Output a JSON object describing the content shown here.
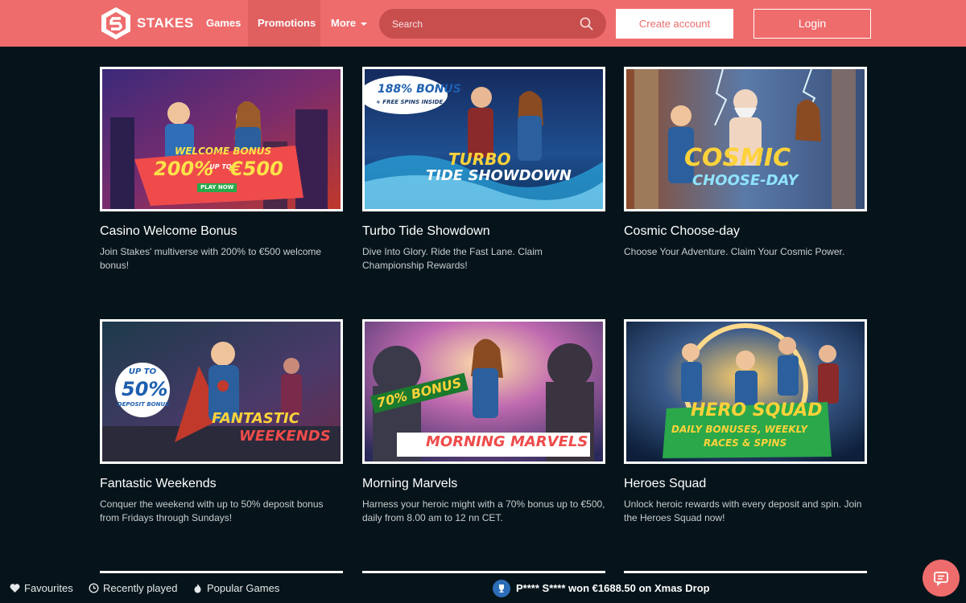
{
  "header": {
    "brand": "STAKES",
    "nav": {
      "games": "Games",
      "promotions": "Promotions",
      "more": "More"
    },
    "search": {
      "placeholder": "Search"
    },
    "create_account": "Create account",
    "login": "Login",
    "colors": {
      "accent": "#ef6c6c",
      "active_nav": "#e05f5f",
      "background": "#05141a"
    }
  },
  "promotions": [
    {
      "title": "Casino Welcome Bonus",
      "description": "Join Stakes' multiverse with 200% to €500 welcome bonus!",
      "banner": {
        "line1": "WELCOME BONUS",
        "line2": "200%",
        "line3": "UP TO",
        "line4": "€500",
        "cta": "PLAY NOW"
      }
    },
    {
      "title": "Turbo Tide Showdown",
      "description": "Dive Into Glory. Ride the Fast Lane. Claim Championship Rewards!",
      "banner": {
        "line1": "188% BONUS",
        "line2": "+ FREE SPINS INSIDE",
        "line3": "TURBO",
        "line4": "TIDE SHOWDOWN"
      }
    },
    {
      "title": "Cosmic Choose-day",
      "description": "Choose Your Adventure. Claim Your Cosmic Power.",
      "banner": {
        "line1": "COSMIC",
        "line2": "CHOOSE-DAY"
      }
    },
    {
      "title": "Fantastic Weekends",
      "description": "Conquer the weekend with up to 50% deposit bonus from Fridays through Sundays!",
      "banner": {
        "line1": "UP TO",
        "line2": "50%",
        "line3": "DEPOSIT BONUS",
        "line4": "FANTASTIC",
        "line5": "WEEKENDS"
      }
    },
    {
      "title": "Morning Marvels",
      "description": "Harness your heroic might with a 70% bonus up to €500, daily from 8.00 am to 12 nn CET.",
      "banner": {
        "line1": "70% BONUS",
        "line2": "MORNING MARVELS"
      }
    },
    {
      "title": "Heroes Squad",
      "description": "Unlock heroic rewards with every deposit and spin. Join the Heroes Squad now!",
      "banner": {
        "line1": "HERO SQUAD",
        "line2": "DAILY BONUSES, WEEKLY",
        "line3": "RACES & SPINS"
      }
    }
  ],
  "bottom_bar": {
    "favourites": "Favourites",
    "recently_played": "Recently played",
    "popular_games": "Popular Games",
    "ticker": "P**** S**** won €1688.50 on Xmas Drop"
  },
  "icons": [
    "stakes-logo-icon",
    "search-icon",
    "heart-icon",
    "clock-icon",
    "flame-icon",
    "trophy-icon",
    "chat-icon"
  ]
}
